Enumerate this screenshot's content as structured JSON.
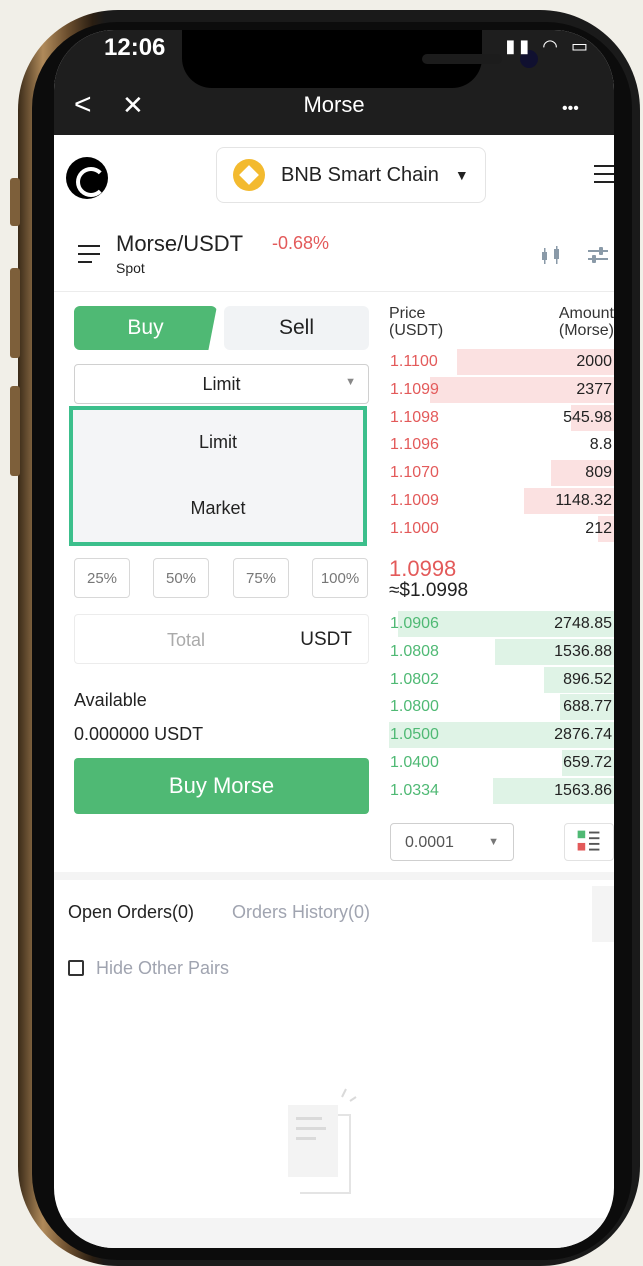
{
  "status_bar": {
    "time": "12:06"
  },
  "nav": {
    "title": "Morse",
    "back_glyph": "<",
    "close_glyph": "✕",
    "more_glyph": "•••"
  },
  "header": {
    "chain": "BNB Smart Chain"
  },
  "pair": {
    "name": "Morse/USDT",
    "change": "-0.68%",
    "type": "Spot"
  },
  "trade": {
    "buy_tab": "Buy",
    "sell_tab": "Sell",
    "order_type": "Limit",
    "order_type_options": [
      "Limit",
      "Market"
    ],
    "percent_buttons": [
      "25%",
      "50%",
      "75%",
      "100%"
    ],
    "total_placeholder": "Total",
    "total_unit": "USDT",
    "available_label": "Available",
    "available_value": "0.000000 USDT",
    "buy_button": "Buy Morse"
  },
  "orderbook": {
    "price_header": "Price",
    "price_unit": "(USDT)",
    "amount_header": "Amount",
    "amount_unit": "(Morse)",
    "asks": [
      {
        "price": "1.1100",
        "amount": "2000",
        "depth": 0.7
      },
      {
        "price": "1.1099",
        "amount": "2377",
        "depth": 0.82
      },
      {
        "price": "1.1098",
        "amount": "545.98",
        "depth": 0.19
      },
      {
        "price": "1.1096",
        "amount": "8.8",
        "depth": 0.0
      },
      {
        "price": "1.1070",
        "amount": "809",
        "depth": 0.28
      },
      {
        "price": "1.1009",
        "amount": "1148.32",
        "depth": 0.4
      },
      {
        "price": "1.1000",
        "amount": "212",
        "depth": 0.07
      }
    ],
    "last_price": "1.0998",
    "last_price_usd": "≈$1.0998",
    "bids": [
      {
        "price": "1.0906",
        "amount": "2748.85",
        "depth": 0.96
      },
      {
        "price": "1.0808",
        "amount": "1536.88",
        "depth": 0.53
      },
      {
        "price": "1.0802",
        "amount": "896.52",
        "depth": 0.31
      },
      {
        "price": "1.0800",
        "amount": "688.77",
        "depth": 0.24
      },
      {
        "price": "1.0500",
        "amount": "2876.74",
        "depth": 1.0
      },
      {
        "price": "1.0400",
        "amount": "659.72",
        "depth": 0.23
      },
      {
        "price": "1.0334",
        "amount": "1563.86",
        "depth": 0.54
      }
    ],
    "precision": "0.0001"
  },
  "orders": {
    "open_tab": "Open Orders(0)",
    "history_tab": "Orders History(0)",
    "hide_label": "Hide Other Pairs"
  },
  "colors": {
    "buy": "#4fb974",
    "sell": "#e35a5a",
    "ask_bar": "#fbe1e1",
    "bid_bar": "#dff3e6",
    "dropdown_outline": "#3cbf8c"
  }
}
